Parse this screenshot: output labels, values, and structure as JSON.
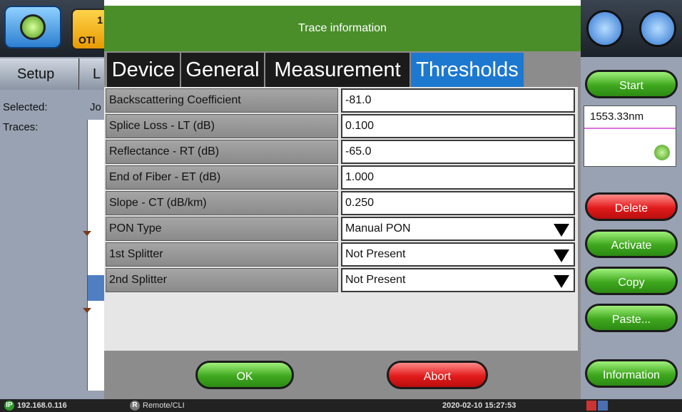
{
  "left_panel": {
    "app_badge_number": "1",
    "app_badge_text": "OTI",
    "setup_tab": "Setup",
    "second_tab_fragment": "L",
    "selected_label": "Selected:",
    "selected_value_fragment": "Jo",
    "traces_label": "Traces:"
  },
  "dialog": {
    "title": "Trace information",
    "tabs": [
      "Device",
      "General",
      "Measurement",
      "Thresholds"
    ],
    "active_tab": "Thresholds",
    "rows": [
      {
        "label": "Backscattering Coefficient",
        "value": "-81.0"
      },
      {
        "label": "Splice Loss - LT (dB)",
        "value": "0.100"
      },
      {
        "label": "Reflectance - RT (dB)",
        "value": "-65.0"
      },
      {
        "label": "End of Fiber - ET (dB)",
        "value": "1.000"
      },
      {
        "label": "Slope - CT (dB/km)",
        "value": "0.250"
      },
      {
        "label": "PON Type",
        "value": "Manual PON",
        "dropdown": true
      },
      {
        "label": "1st Splitter",
        "value": "Not Present",
        "dropdown": true
      },
      {
        "label": "2nd Splitter",
        "value": "Not Present",
        "dropdown": true
      }
    ],
    "ok_label": "OK",
    "abort_label": "Abort"
  },
  "right_panel": {
    "start_label": "Start",
    "wavelength": "1553.33nm",
    "delete_label": "Delete",
    "activate_label": "Activate",
    "copy_label": "Copy",
    "paste_label": "Paste...",
    "information_label": "Information"
  },
  "status_bar": {
    "ip_badge": "IP",
    "ip_address": "192.168.0.116",
    "remote_badge": "R",
    "remote_label": "Remote/CLI",
    "datetime": "2020-02-10  15:27:53"
  },
  "colors": {
    "title_green": "#4a8e2a",
    "tab_active_blue": "#1d78d0",
    "button_green": "#3fa81e",
    "button_red": "#e21b1b"
  }
}
